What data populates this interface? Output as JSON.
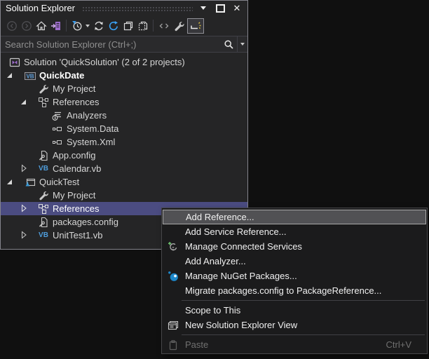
{
  "window": {
    "title": "Solution Explorer"
  },
  "search": {
    "placeholder": "Search Solution Explorer (Ctrl+;)"
  },
  "icons": {
    "vb_glyph": "VB"
  },
  "toolbar": {
    "buttons": [
      {
        "icon": "back-icon",
        "disabled": true
      },
      {
        "icon": "forward-icon",
        "disabled": true
      },
      {
        "icon": "home-icon"
      },
      {
        "icon": "sync-with-active-document-icon"
      },
      {
        "icon": "pending-changes-filter-icon",
        "has_dropdown": true
      },
      {
        "icon": "refresh-icon"
      },
      {
        "icon": "sync-icon"
      },
      {
        "icon": "collapse-all-icon"
      },
      {
        "icon": "show-all-files-icon"
      },
      {
        "icon": "view-code-icon"
      },
      {
        "icon": "properties-icon"
      },
      {
        "icon": "preview-selected-items-icon",
        "toggled": true
      }
    ]
  },
  "tree": {
    "items": [
      {
        "label": "Solution 'QuickSolution' (2 of 2 projects)",
        "level": 0,
        "icon": "solution-icon"
      },
      {
        "label": "QuickDate",
        "level": 1,
        "icon": "vb-project-icon",
        "arrow": "expanded",
        "bold": true
      },
      {
        "label": "My Project",
        "level": 2,
        "icon": "my-project-icon"
      },
      {
        "label": "References",
        "level": 2,
        "icon": "references-icon",
        "arrow": "expanded"
      },
      {
        "label": "Analyzers",
        "level": 3,
        "icon": "analyzers-icon"
      },
      {
        "label": "System.Data",
        "level": 3,
        "icon": "assembly-icon"
      },
      {
        "label": "System.Xml",
        "level": 3,
        "icon": "assembly-icon"
      },
      {
        "label": "App.config",
        "level": 2,
        "icon": "config-file-icon"
      },
      {
        "label": "Calendar.vb",
        "level": 2,
        "icon": "vb-file-icon",
        "arrow": "collapsed"
      },
      {
        "label": "QuickTest",
        "level": 1,
        "icon": "test-project-icon",
        "arrow": "expanded"
      },
      {
        "label": "My Project",
        "level": 2,
        "icon": "my-project-icon"
      },
      {
        "label": "References",
        "level": 2,
        "icon": "references-icon",
        "arrow": "collapsed",
        "selected": true
      },
      {
        "label": "packages.config",
        "level": 2,
        "icon": "config-file-icon"
      },
      {
        "label": "UnitTest1.vb",
        "level": 2,
        "icon": "vb-file-icon",
        "arrow": "collapsed"
      }
    ]
  },
  "menu": {
    "items": [
      {
        "label": "Add Reference...",
        "highlighted": true
      },
      {
        "label": "Add Service Reference..."
      },
      {
        "label": "Manage Connected Services",
        "icon": "connected-services-icon"
      },
      {
        "label": "Add Analyzer..."
      },
      {
        "label": "Manage NuGet Packages...",
        "icon": "nuget-icon"
      },
      {
        "label": "Migrate packages.config to PackageReference..."
      },
      {
        "label": "Scope to This"
      },
      {
        "label": "New Solution Explorer View",
        "icon": "new-solution-explorer-view-icon"
      },
      {
        "label": "Paste",
        "icon": "paste-icon",
        "disabled": true,
        "shortcut": "Ctrl+V"
      }
    ]
  },
  "colors": {
    "selection": "#4b4c81",
    "menu_highlight": "#515154",
    "panel_background": "#252526",
    "menu_background": "#1b1b1c",
    "vb_blue": "#4f9ddb",
    "accent_blue": "#3aa0f3",
    "purple": "#9b6bc9"
  }
}
